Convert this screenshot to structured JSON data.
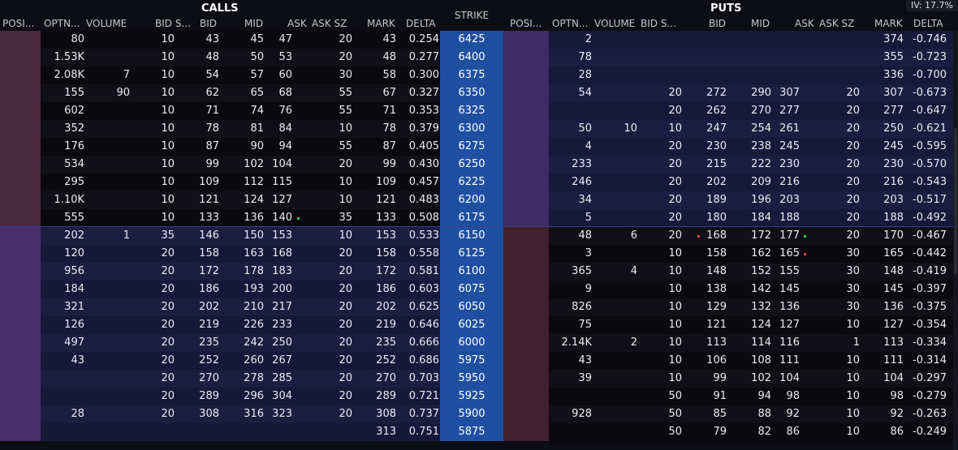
{
  "headers": {
    "calls_title": "CALLS",
    "puts_title": "PUTS",
    "strike": "STRIKE",
    "iv": "IV: 17.7%",
    "call_cols": [
      "POSI...",
      "OPTN...",
      "VOLUME",
      "BID S...",
      "BID",
      "MID",
      "ASK",
      "ASK SZ",
      "MARK",
      "DELTA"
    ],
    "put_cols": [
      "POSI...",
      "OPTN...",
      "VOLUME",
      "BID S...",
      "BID",
      "MID",
      "ASK",
      "ASK SZ",
      "MARK",
      "DELTA"
    ]
  },
  "colors": {
    "call_itm_pos": "#4a2a40",
    "call_itm_row": "#0b0b0f",
    "call_otm_pos": "#4a2f6e",
    "call_otm_row": "#1a1a3c",
    "strike_bg": "#1f4fa0",
    "put_otm_pos": "#3e2c66",
    "put_otm_row": "#191a3c",
    "put_itm_pos": "#43202e",
    "put_itm_row": "#0b0b0f",
    "separator": "#3a3d88",
    "green_dot": "#3cc34a",
    "red_dot": "#e03a3a"
  },
  "rows": [
    {
      "strike": "6425",
      "call": {
        "oi": "80",
        "vol": "",
        "bidsz": "10",
        "bid": "43",
        "mid": "45",
        "ask": "47",
        "asksz": "20",
        "mark": "43",
        "delta": "0.254"
      },
      "put": {
        "oi": "2",
        "vol": "",
        "bidsz": "",
        "bid": "",
        "mid": "",
        "ask": "",
        "asksz": "",
        "mark": "374",
        "delta": "-0.746"
      }
    },
    {
      "strike": "6400",
      "call": {
        "oi": "1.53K",
        "vol": "",
        "bidsz": "10",
        "bid": "48",
        "mid": "50",
        "ask": "53",
        "asksz": "20",
        "mark": "48",
        "delta": "0.277"
      },
      "put": {
        "oi": "78",
        "vol": "",
        "bidsz": "",
        "bid": "",
        "mid": "",
        "ask": "",
        "asksz": "",
        "mark": "355",
        "delta": "-0.723"
      }
    },
    {
      "strike": "6375",
      "call": {
        "oi": "2.08K",
        "vol": "7",
        "bidsz": "10",
        "bid": "54",
        "mid": "57",
        "ask": "60",
        "asksz": "30",
        "mark": "58",
        "delta": "0.300"
      },
      "put": {
        "oi": "28",
        "vol": "",
        "bidsz": "",
        "bid": "",
        "mid": "",
        "ask": "",
        "asksz": "",
        "mark": "336",
        "delta": "-0.700"
      }
    },
    {
      "strike": "6350",
      "call": {
        "oi": "155",
        "vol": "90",
        "bidsz": "10",
        "bid": "62",
        "mid": "65",
        "ask": "68",
        "asksz": "55",
        "mark": "67",
        "delta": "0.327"
      },
      "put": {
        "oi": "54",
        "vol": "",
        "bidsz": "20",
        "bid": "272",
        "mid": "290",
        "ask": "307",
        "asksz": "20",
        "mark": "307",
        "delta": "-0.673"
      }
    },
    {
      "strike": "6325",
      "call": {
        "oi": "602",
        "vol": "",
        "bidsz": "10",
        "bid": "71",
        "mid": "74",
        "ask": "76",
        "asksz": "55",
        "mark": "71",
        "delta": "0.353"
      },
      "put": {
        "oi": "",
        "vol": "",
        "bidsz": "20",
        "bid": "262",
        "mid": "270",
        "ask": "277",
        "asksz": "20",
        "mark": "277",
        "delta": "-0.647"
      }
    },
    {
      "strike": "6300",
      "call": {
        "oi": "352",
        "vol": "",
        "bidsz": "10",
        "bid": "78",
        "mid": "81",
        "ask": "84",
        "asksz": "10",
        "mark": "78",
        "delta": "0.379"
      },
      "put": {
        "oi": "50",
        "vol": "10",
        "bidsz": "10",
        "bid": "247",
        "mid": "254",
        "ask": "261",
        "asksz": "20",
        "mark": "250",
        "delta": "-0.621"
      }
    },
    {
      "strike": "6275",
      "call": {
        "oi": "176",
        "vol": "",
        "bidsz": "10",
        "bid": "87",
        "mid": "90",
        "ask": "94",
        "asksz": "55",
        "mark": "87",
        "delta": "0.405"
      },
      "put": {
        "oi": "4",
        "vol": "",
        "bidsz": "20",
        "bid": "230",
        "mid": "238",
        "ask": "245",
        "asksz": "20",
        "mark": "245",
        "delta": "-0.595"
      }
    },
    {
      "strike": "6250",
      "call": {
        "oi": "534",
        "vol": "",
        "bidsz": "10",
        "bid": "99",
        "mid": "102",
        "ask": "104",
        "asksz": "20",
        "mark": "99",
        "delta": "0.430"
      },
      "put": {
        "oi": "233",
        "vol": "",
        "bidsz": "20",
        "bid": "215",
        "mid": "222",
        "ask": "230",
        "asksz": "20",
        "mark": "230",
        "delta": "-0.570"
      }
    },
    {
      "strike": "6225",
      "call": {
        "oi": "295",
        "vol": "",
        "bidsz": "10",
        "bid": "109",
        "mid": "112",
        "ask": "115",
        "asksz": "10",
        "mark": "109",
        "delta": "0.457"
      },
      "put": {
        "oi": "246",
        "vol": "",
        "bidsz": "20",
        "bid": "202",
        "mid": "209",
        "ask": "216",
        "asksz": "20",
        "mark": "216",
        "delta": "-0.543"
      }
    },
    {
      "strike": "6200",
      "call": {
        "oi": "1.10K",
        "vol": "",
        "bidsz": "10",
        "bid": "121",
        "mid": "124",
        "ask": "127",
        "asksz": "10",
        "mark": "121",
        "delta": "0.483"
      },
      "put": {
        "oi": "34",
        "vol": "",
        "bidsz": "20",
        "bid": "189",
        "mid": "196",
        "ask": "203",
        "asksz": "20",
        "mark": "203",
        "delta": "-0.517"
      }
    },
    {
      "strike": "6175",
      "call": {
        "oi": "555",
        "vol": "",
        "bidsz": "10",
        "bid": "133",
        "mid": "136",
        "ask": "140",
        "asksz": "35",
        "mark": "133",
        "delta": "0.508"
      },
      "put": {
        "oi": "5",
        "vol": "",
        "bidsz": "20",
        "bid": "180",
        "mid": "184",
        "ask": "188",
        "asksz": "20",
        "mark": "188",
        "delta": "-0.492"
      }
    },
    {
      "strike": "6150",
      "call": {
        "oi": "202",
        "vol": "1",
        "bidsz": "35",
        "bid": "146",
        "mid": "150",
        "ask": "153",
        "asksz": "10",
        "mark": "153",
        "delta": "0.533"
      },
      "put": {
        "oi": "48",
        "vol": "6",
        "bidsz": "20",
        "bid": "168",
        "mid": "172",
        "ask": "177",
        "asksz": "20",
        "mark": "170",
        "delta": "-0.467"
      }
    },
    {
      "strike": "6125",
      "call": {
        "oi": "120",
        "vol": "",
        "bidsz": "20",
        "bid": "158",
        "mid": "163",
        "ask": "168",
        "asksz": "20",
        "mark": "158",
        "delta": "0.558"
      },
      "put": {
        "oi": "3",
        "vol": "",
        "bidsz": "10",
        "bid": "158",
        "mid": "162",
        "ask": "165",
        "asksz": "30",
        "mark": "165",
        "delta": "-0.442"
      }
    },
    {
      "strike": "6100",
      "call": {
        "oi": "956",
        "vol": "",
        "bidsz": "20",
        "bid": "172",
        "mid": "178",
        "ask": "183",
        "asksz": "20",
        "mark": "172",
        "delta": "0.581"
      },
      "put": {
        "oi": "365",
        "vol": "4",
        "bidsz": "10",
        "bid": "148",
        "mid": "152",
        "ask": "155",
        "asksz": "30",
        "mark": "148",
        "delta": "-0.419"
      }
    },
    {
      "strike": "6075",
      "call": {
        "oi": "184",
        "vol": "",
        "bidsz": "20",
        "bid": "186",
        "mid": "193",
        "ask": "200",
        "asksz": "20",
        "mark": "186",
        "delta": "0.603"
      },
      "put": {
        "oi": "9",
        "vol": "",
        "bidsz": "10",
        "bid": "138",
        "mid": "142",
        "ask": "145",
        "asksz": "30",
        "mark": "145",
        "delta": "-0.397"
      }
    },
    {
      "strike": "6050",
      "call": {
        "oi": "321",
        "vol": "",
        "bidsz": "20",
        "bid": "202",
        "mid": "210",
        "ask": "217",
        "asksz": "20",
        "mark": "202",
        "delta": "0.625"
      },
      "put": {
        "oi": "826",
        "vol": "",
        "bidsz": "10",
        "bid": "129",
        "mid": "132",
        "ask": "136",
        "asksz": "30",
        "mark": "136",
        "delta": "-0.375"
      }
    },
    {
      "strike": "6025",
      "call": {
        "oi": "126",
        "vol": "",
        "bidsz": "20",
        "bid": "219",
        "mid": "226",
        "ask": "233",
        "asksz": "20",
        "mark": "219",
        "delta": "0.646"
      },
      "put": {
        "oi": "75",
        "vol": "",
        "bidsz": "10",
        "bid": "121",
        "mid": "124",
        "ask": "127",
        "asksz": "10",
        "mark": "127",
        "delta": "-0.354"
      }
    },
    {
      "strike": "6000",
      "call": {
        "oi": "497",
        "vol": "",
        "bidsz": "20",
        "bid": "235",
        "mid": "242",
        "ask": "250",
        "asksz": "20",
        "mark": "235",
        "delta": "0.666"
      },
      "put": {
        "oi": "2.14K",
        "vol": "2",
        "bidsz": "10",
        "bid": "113",
        "mid": "114",
        "ask": "116",
        "asksz": "1",
        "mark": "113",
        "delta": "-0.334"
      }
    },
    {
      "strike": "5975",
      "call": {
        "oi": "43",
        "vol": "",
        "bidsz": "20",
        "bid": "252",
        "mid": "260",
        "ask": "267",
        "asksz": "20",
        "mark": "252",
        "delta": "0.686"
      },
      "put": {
        "oi": "43",
        "vol": "",
        "bidsz": "10",
        "bid": "106",
        "mid": "108",
        "ask": "111",
        "asksz": "10",
        "mark": "111",
        "delta": "-0.314"
      }
    },
    {
      "strike": "5950",
      "call": {
        "oi": "",
        "vol": "",
        "bidsz": "20",
        "bid": "270",
        "mid": "278",
        "ask": "285",
        "asksz": "20",
        "mark": "270",
        "delta": "0.703"
      },
      "put": {
        "oi": "39",
        "vol": "",
        "bidsz": "10",
        "bid": "99",
        "mid": "102",
        "ask": "104",
        "asksz": "10",
        "mark": "104",
        "delta": "-0.297"
      }
    },
    {
      "strike": "5925",
      "call": {
        "oi": "",
        "vol": "",
        "bidsz": "20",
        "bid": "289",
        "mid": "296",
        "ask": "304",
        "asksz": "20",
        "mark": "289",
        "delta": "0.721"
      },
      "put": {
        "oi": "",
        "vol": "",
        "bidsz": "50",
        "bid": "91",
        "mid": "94",
        "ask": "98",
        "asksz": "10",
        "mark": "98",
        "delta": "-0.279"
      }
    },
    {
      "strike": "5900",
      "call": {
        "oi": "28",
        "vol": "",
        "bidsz": "20",
        "bid": "308",
        "mid": "316",
        "ask": "323",
        "asksz": "20",
        "mark": "308",
        "delta": "0.737"
      },
      "put": {
        "oi": "928",
        "vol": "",
        "bidsz": "50",
        "bid": "85",
        "mid": "88",
        "ask": "92",
        "asksz": "10",
        "mark": "92",
        "delta": "-0.263"
      }
    },
    {
      "strike": "5875",
      "call": {
        "oi": "",
        "vol": "",
        "bidsz": "",
        "bid": "",
        "mid": "",
        "ask": "",
        "asksz": "",
        "mark": "313",
        "delta": "0.751"
      },
      "put": {
        "oi": "",
        "vol": "",
        "bidsz": "50",
        "bid": "79",
        "mid": "82",
        "ask": "86",
        "asksz": "10",
        "mark": "86",
        "delta": "-0.249"
      }
    }
  ],
  "indicators": [
    {
      "row": 10,
      "side": "call",
      "field": "ask",
      "color": "green"
    },
    {
      "row": 11,
      "side": "put",
      "field": "bid",
      "color": "red"
    },
    {
      "row": 11,
      "side": "put",
      "field": "ask",
      "color": "green"
    },
    {
      "row": 12,
      "side": "put",
      "field": "ask",
      "color": "red"
    }
  ],
  "atm_break_index": 11
}
